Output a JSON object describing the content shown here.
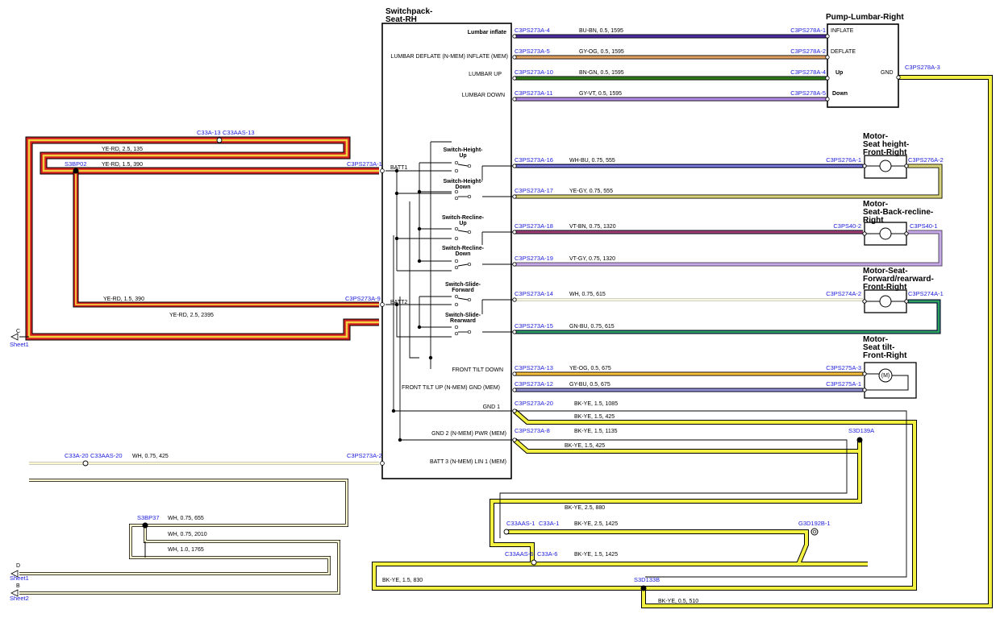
{
  "switchpack": {
    "title_line1": "Switchpack-",
    "title_line2": "Seat-RH",
    "pins": [
      "Lumbar inflate",
      "LUMBAR DEFLATE (N-MEM) INFLATE (MEM)",
      "LUMBAR UP",
      "LUMBAR DOWN",
      "FRONT TILT DOWN",
      "FRONT TILT UP (N-MEM) GND (MEM)",
      "GND 1",
      "GND 2 (N-MEM) PWR (MEM)",
      "BATT 3 (N-MEM) LIN 1 (MEM)"
    ],
    "batt1": "BATT1",
    "batt2": "BATT2",
    "switches": [
      [
        "Switch-Height-",
        "Up"
      ],
      [
        "Switch-Height-",
        "Down"
      ],
      [
        "Switch-Recline-",
        "Up"
      ],
      [
        "Switch-Recline-",
        "Down"
      ],
      [
        "Switch-Slide-",
        "Forward"
      ],
      [
        "Switch-Slide-",
        "Rearward"
      ]
    ]
  },
  "pump": {
    "title": "Pump-Lumbar-Right",
    "pins": [
      "INFLATE",
      "DEFLATE",
      "Up",
      "Down",
      "GND"
    ]
  },
  "motors": {
    "height": [
      "Motor-",
      "Seat height-",
      "Front-Right"
    ],
    "recline": [
      "Motor-",
      "Seat-Back-recline-",
      "Right"
    ],
    "slide": [
      "Motor-Seat-",
      "Forward/rearward-",
      "Front-Right"
    ],
    "tilt": [
      "Motor-",
      "Seat tilt-",
      "Front-Right"
    ],
    "tilt_inner": "(M)"
  },
  "wires": [
    {
      "from": "C3PS273A-4",
      "to": "C3PS278A-1",
      "label": "BU-BN,  0.5,  1595",
      "color": "#4a2ca0"
    },
    {
      "from": "C3PS273A-5",
      "to": "C3PS278A-2",
      "label": "GY-OG,  0.5,  1595",
      "color": "#e0a060"
    },
    {
      "from": "C3PS273A-10",
      "to": "C3PS278A-4",
      "label": "BN-GN,  0.5,  1595",
      "color": "#2e7a18"
    },
    {
      "from": "C3PS273A-11",
      "to": "C3PS278A-5",
      "label": "GY-VT,  0.5,  1595",
      "color": "#b48ae8"
    },
    {
      "from": "C3PS273A-16",
      "to": "C3PS276A-1",
      "label": "WH-BU,  0.75,  555",
      "color": "#3a3ac8"
    },
    {
      "from": "C3PS273A-17",
      "to": "",
      "label": "YE-GY,  0.75,  555",
      "color": "#e6e060"
    },
    {
      "from": "C3PS273A-18",
      "to": "C3PS40-2",
      "label": "VT-BN,  0.75,  1320",
      "color": "#8a3a8a"
    },
    {
      "from": "C3PS273A-19",
      "to": "",
      "label": "VT-GY,  0.75,  1320",
      "color": "#b48ae8"
    },
    {
      "from": "C3PS273A-14",
      "to": "C3PS274A-2",
      "label": "WH,  0.75,  615",
      "color": "#f4f0c8"
    },
    {
      "from": "C3PS273A-15",
      "to": "",
      "label": "GN-BU,  0.75,  615",
      "color": "#1a6a8a"
    },
    {
      "from": "C3PS273A-13",
      "to": "C3PS275A-3",
      "label": "YE-OG,  0.5,  675",
      "color": "#f2b020"
    },
    {
      "from": "C3PS273A-12",
      "to": "C3PS275A-1",
      "label": "GY-BU,  0.5,  675",
      "color": "#7070d0"
    },
    {
      "from": "C3PS273A-20",
      "to": "",
      "label": "BK-YE,  1.5,  1085",
      "color": "#f2f040"
    },
    {
      "from": "C3PS273A-8",
      "to": "S3D139A",
      "label": "BK-YE,  1.5,  1135",
      "color": "#f2f040"
    }
  ],
  "right_connectors": {
    "pump_gnd": "C3PS278A-3",
    "height_2": "C3PS276A-2",
    "recline_1": "C3PS40-1",
    "slide_1": "C3PS274A-1"
  },
  "left": {
    "c33a13": "C33A-13",
    "c33aas13": "C33AAS-13",
    "yerd_135": "YE-RD,  2.5,  135",
    "s3bp02": "S3BP02",
    "yerd_390a": "YE-RD,  1.5,  390",
    "c3ps273a1": "C3PS273A-1",
    "yerd_390b": "YE-RD,  1.5,  390",
    "c3ps273a9": "C3PS273A-9",
    "yerd_2395": "YE-RD,  2.5,  2395",
    "sheet_c": "C",
    "sheet1a": "Sheet1",
    "c33a20": "C33A-20",
    "c33aas20": "C33AAS-20",
    "wh_425": "WH,  0.75,  425",
    "c3ps273a2": "C3PS273A-2",
    "s3bp37": "S3BP37",
    "wh_655": "WH,  0.75,  655",
    "wh_2010": "WH,  0.75,  2010",
    "wh_1765": "WH,  1.0,  1765",
    "sheet_d": "D",
    "sheet1b": "Sheet1",
    "sheet_b": "B",
    "sheet2": "Sheet2"
  },
  "ground": {
    "bkye_425a": "BK-YE,  1.5,  425",
    "bkye_425b": "BK-YE,  1.5,  425",
    "bkye_880": "BK-YE,  2.5,  880",
    "c33aas1": "C33AAS-1",
    "c33a1": "C33A-1",
    "bkye_1425a": "BK-YE,  2.5,  1425",
    "g3d192b1": "G3D192B-1",
    "c33aas6": "C33AAS-6",
    "c33a6": "C33A-6",
    "bkye_1425b": "BK-YE,  1.5,  1425",
    "bkye_830": "BK-YE,  1.5,  830",
    "s3d133b": "S3D133B",
    "bkye_510": "BK-YE,  0.5,  510"
  }
}
